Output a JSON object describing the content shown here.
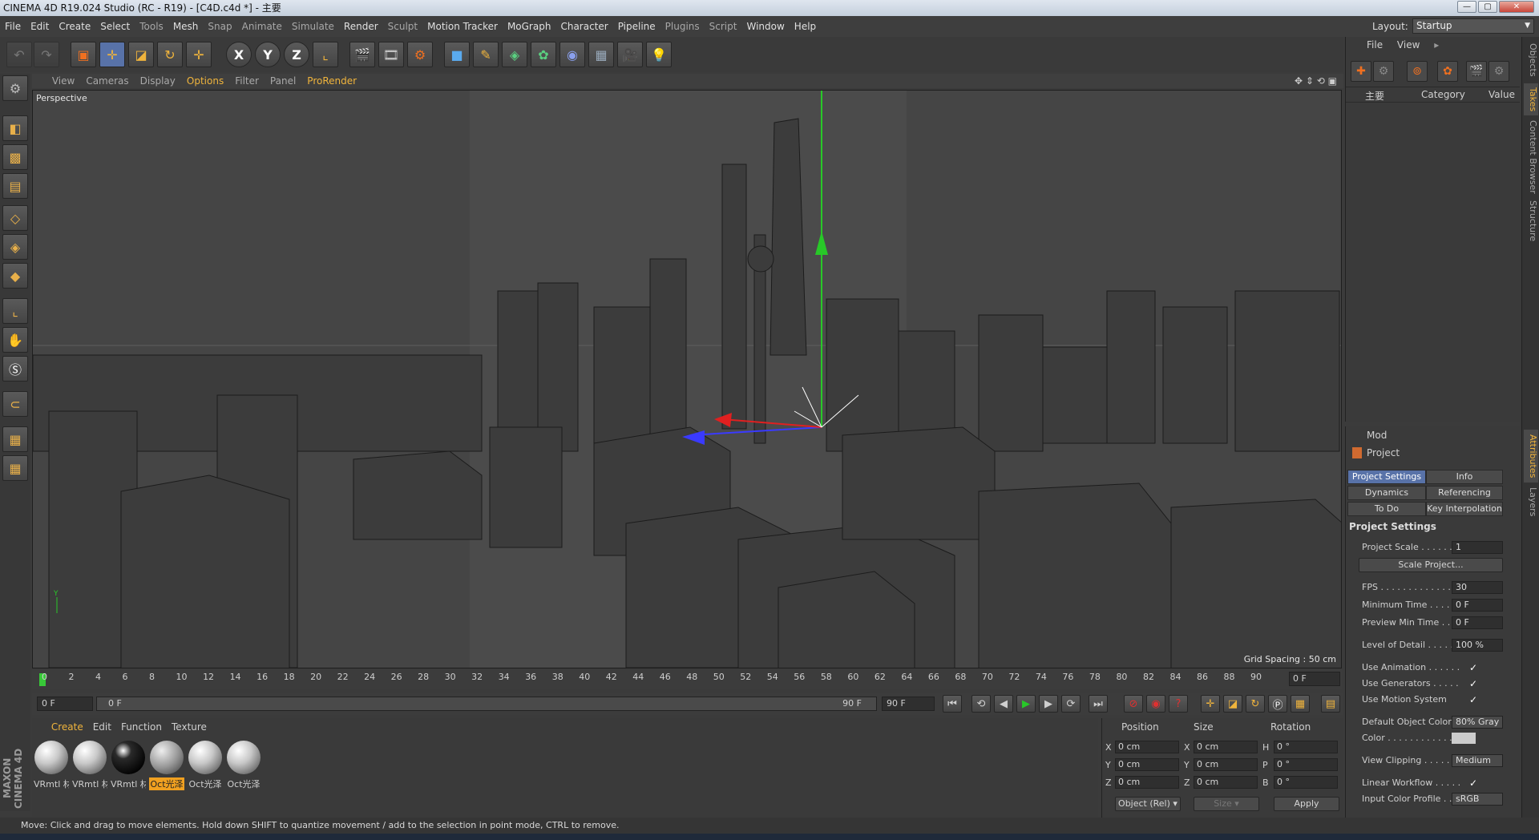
{
  "titlebar": {
    "title": "CINEMA 4D R19.024 Studio (RC - R19) - [C4D.c4d *] - 主要"
  },
  "menubar": {
    "items": [
      "File",
      "Edit",
      "Create",
      "Select",
      "Tools",
      "Mesh",
      "Snap",
      "Animate",
      "Simulate",
      "Render",
      "Sculpt",
      "Motion Tracker",
      "MoGraph",
      "Character",
      "Pipeline",
      "Plugins",
      "Script",
      "Window",
      "Help"
    ],
    "layout_label": "Layout:",
    "layout_value": "Startup"
  },
  "toolbar": {
    "icons": [
      "undo-icon",
      "redo-icon",
      "live-selection-icon",
      "move-icon",
      "scale-icon",
      "rotate-icon",
      "recent-tool-icon",
      "x-axis-icon",
      "y-axis-icon",
      "z-axis-icon",
      "coordinate-system-icon",
      "render-view-icon",
      "render-to-picture-viewer-icon",
      "edit-render-settings-icon",
      "cube-icon",
      "pen-icon",
      "subdivision-icon",
      "cloner-icon",
      "deformer-icon",
      "floor-icon",
      "camera-icon",
      "light-icon"
    ],
    "axis_x": "X",
    "axis_y": "Y",
    "axis_z": "Z"
  },
  "viewport": {
    "menu": [
      "View",
      "Cameras",
      "Display",
      "Options",
      "Filter",
      "Panel",
      "ProRender"
    ],
    "title": "Perspective",
    "grid_spacing": "Grid Spacing : 50 cm"
  },
  "timeline": {
    "ticks": [
      "0",
      "2",
      "4",
      "6",
      "8",
      "10",
      "12",
      "14",
      "16",
      "18",
      "20",
      "22",
      "24",
      "26",
      "28",
      "30",
      "32",
      "34",
      "36",
      "38",
      "40",
      "42",
      "44",
      "46",
      "48",
      "50",
      "52",
      "54",
      "56",
      "58",
      "60",
      "62",
      "64",
      "66",
      "68",
      "70",
      "72",
      "74",
      "76",
      "78",
      "80",
      "82",
      "84",
      "86",
      "88",
      "90"
    ],
    "current_frame": "0 F"
  },
  "transport": {
    "start": "0 F",
    "range_start": "0 F",
    "range_end": "90 F",
    "end": "90 F"
  },
  "materials": {
    "menu": [
      "Create",
      "Edit",
      "Function",
      "Texture"
    ],
    "items": [
      "VRmtl 材",
      "VRmtl 材",
      "VRmtl 材",
      "Oct光泽",
      "Oct光泽",
      "Oct光泽"
    ]
  },
  "coordinates": {
    "headers": [
      "Position",
      "Size",
      "Rotation"
    ],
    "rows": [
      {
        "axis": "X",
        "pos": "0 cm",
        "size_axis": "X",
        "size": "0 cm",
        "rot_axis": "H",
        "rot": "0 °"
      },
      {
        "axis": "Y",
        "pos": "0 cm",
        "size_axis": "Y",
        "size": "0 cm",
        "rot_axis": "P",
        "rot": "0 °"
      },
      {
        "axis": "Z",
        "pos": "0 cm",
        "size_axis": "Z",
        "size": "0 cm",
        "rot_axis": "B",
        "rot": "0 °"
      }
    ],
    "mode": "Object (Rel)",
    "size_mode": "Size",
    "apply": "Apply"
  },
  "objects": {
    "menu": [
      "File",
      "View"
    ],
    "col_name": "主要",
    "col_category": "Category",
    "col_value": "Value"
  },
  "attributes": {
    "mode": "Mod",
    "object": "Project",
    "tabs": [
      "Project Settings",
      "Info",
      "Dynamics",
      "Referencing",
      "To Do",
      "Key Interpolation"
    ],
    "section": "Project Settings",
    "props": [
      {
        "label": "Project Scale . . . . . .",
        "value": "1"
      },
      {
        "label": "Scale Project...",
        "value": ""
      },
      {
        "label": "FPS . . . . . . . . . . . . . . .",
        "value": "30"
      },
      {
        "label": "Minimum Time . . . . . .",
        "value": "0 F"
      },
      {
        "label": "Preview Min Time . . . .",
        "value": "0 F"
      },
      {
        "label": "Level of Detail . . . . . .",
        "value": "100 %"
      },
      {
        "label": "Use Animation . . . . . .",
        "value": "✓"
      },
      {
        "label": "Use Generators . . . . .",
        "value": "✓"
      },
      {
        "label": "Use Motion System",
        "value": "✓"
      },
      {
        "label": "Default Object Color",
        "value": "80% Gray"
      },
      {
        "label": "Color . . . . . . . . . . . .",
        "value": ""
      },
      {
        "label": "View Clipping . . . . . . .",
        "value": "Medium"
      },
      {
        "label": "Linear Workflow . . . . .",
        "value": "✓"
      },
      {
        "label": "Input Color Profile . . .",
        "value": "sRGB"
      }
    ]
  },
  "sidetabs": [
    "Objects",
    "Takes",
    "Content Browser",
    "Structure",
    "Attributes",
    "Layers"
  ],
  "status": {
    "text": "Move: Click and drag to move elements. Hold down SHIFT to quantize movement / add to the selection in point mode, CTRL to remove."
  },
  "brand": {
    "text": "MAXON CINEMA 4D"
  },
  "colors": {
    "accent": "#f0b43c",
    "active_tab": "#5872a8",
    "background": "#3b3b3b"
  }
}
